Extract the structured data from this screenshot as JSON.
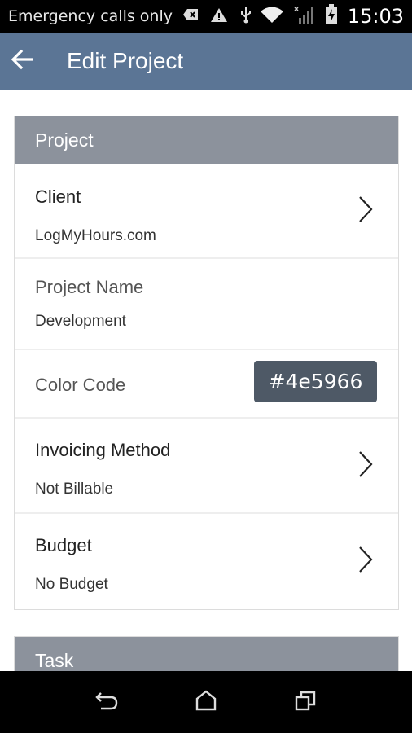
{
  "status_bar": {
    "carrier_text": "Emergency calls only",
    "time": "15:03",
    "icons": [
      "sms-failed-icon",
      "warning-icon",
      "usb-icon",
      "wifi-icon",
      "no-signal-icon",
      "battery-charging-icon"
    ]
  },
  "app_bar": {
    "title": "Edit Project",
    "back_icon": "arrow-back-icon",
    "color": "#5b7595"
  },
  "project_card": {
    "header": "Project",
    "client": {
      "label": "Client",
      "value": "LogMyHours.com"
    },
    "project_name": {
      "label": "Project Name",
      "value": "Development"
    },
    "color_code": {
      "label": "Color Code",
      "value": "#4e5966"
    },
    "invoicing_method": {
      "label": "Invoicing Method",
      "value": "Not Billable"
    },
    "budget": {
      "label": "Budget",
      "value": "No Budget"
    }
  },
  "task_card": {
    "header": "Task"
  },
  "nav_bar": {
    "icons": [
      "back-icon",
      "home-icon",
      "recents-icon"
    ]
  },
  "colors": {
    "header_gray": "#8c929c",
    "color_badge": "#4e5966"
  }
}
